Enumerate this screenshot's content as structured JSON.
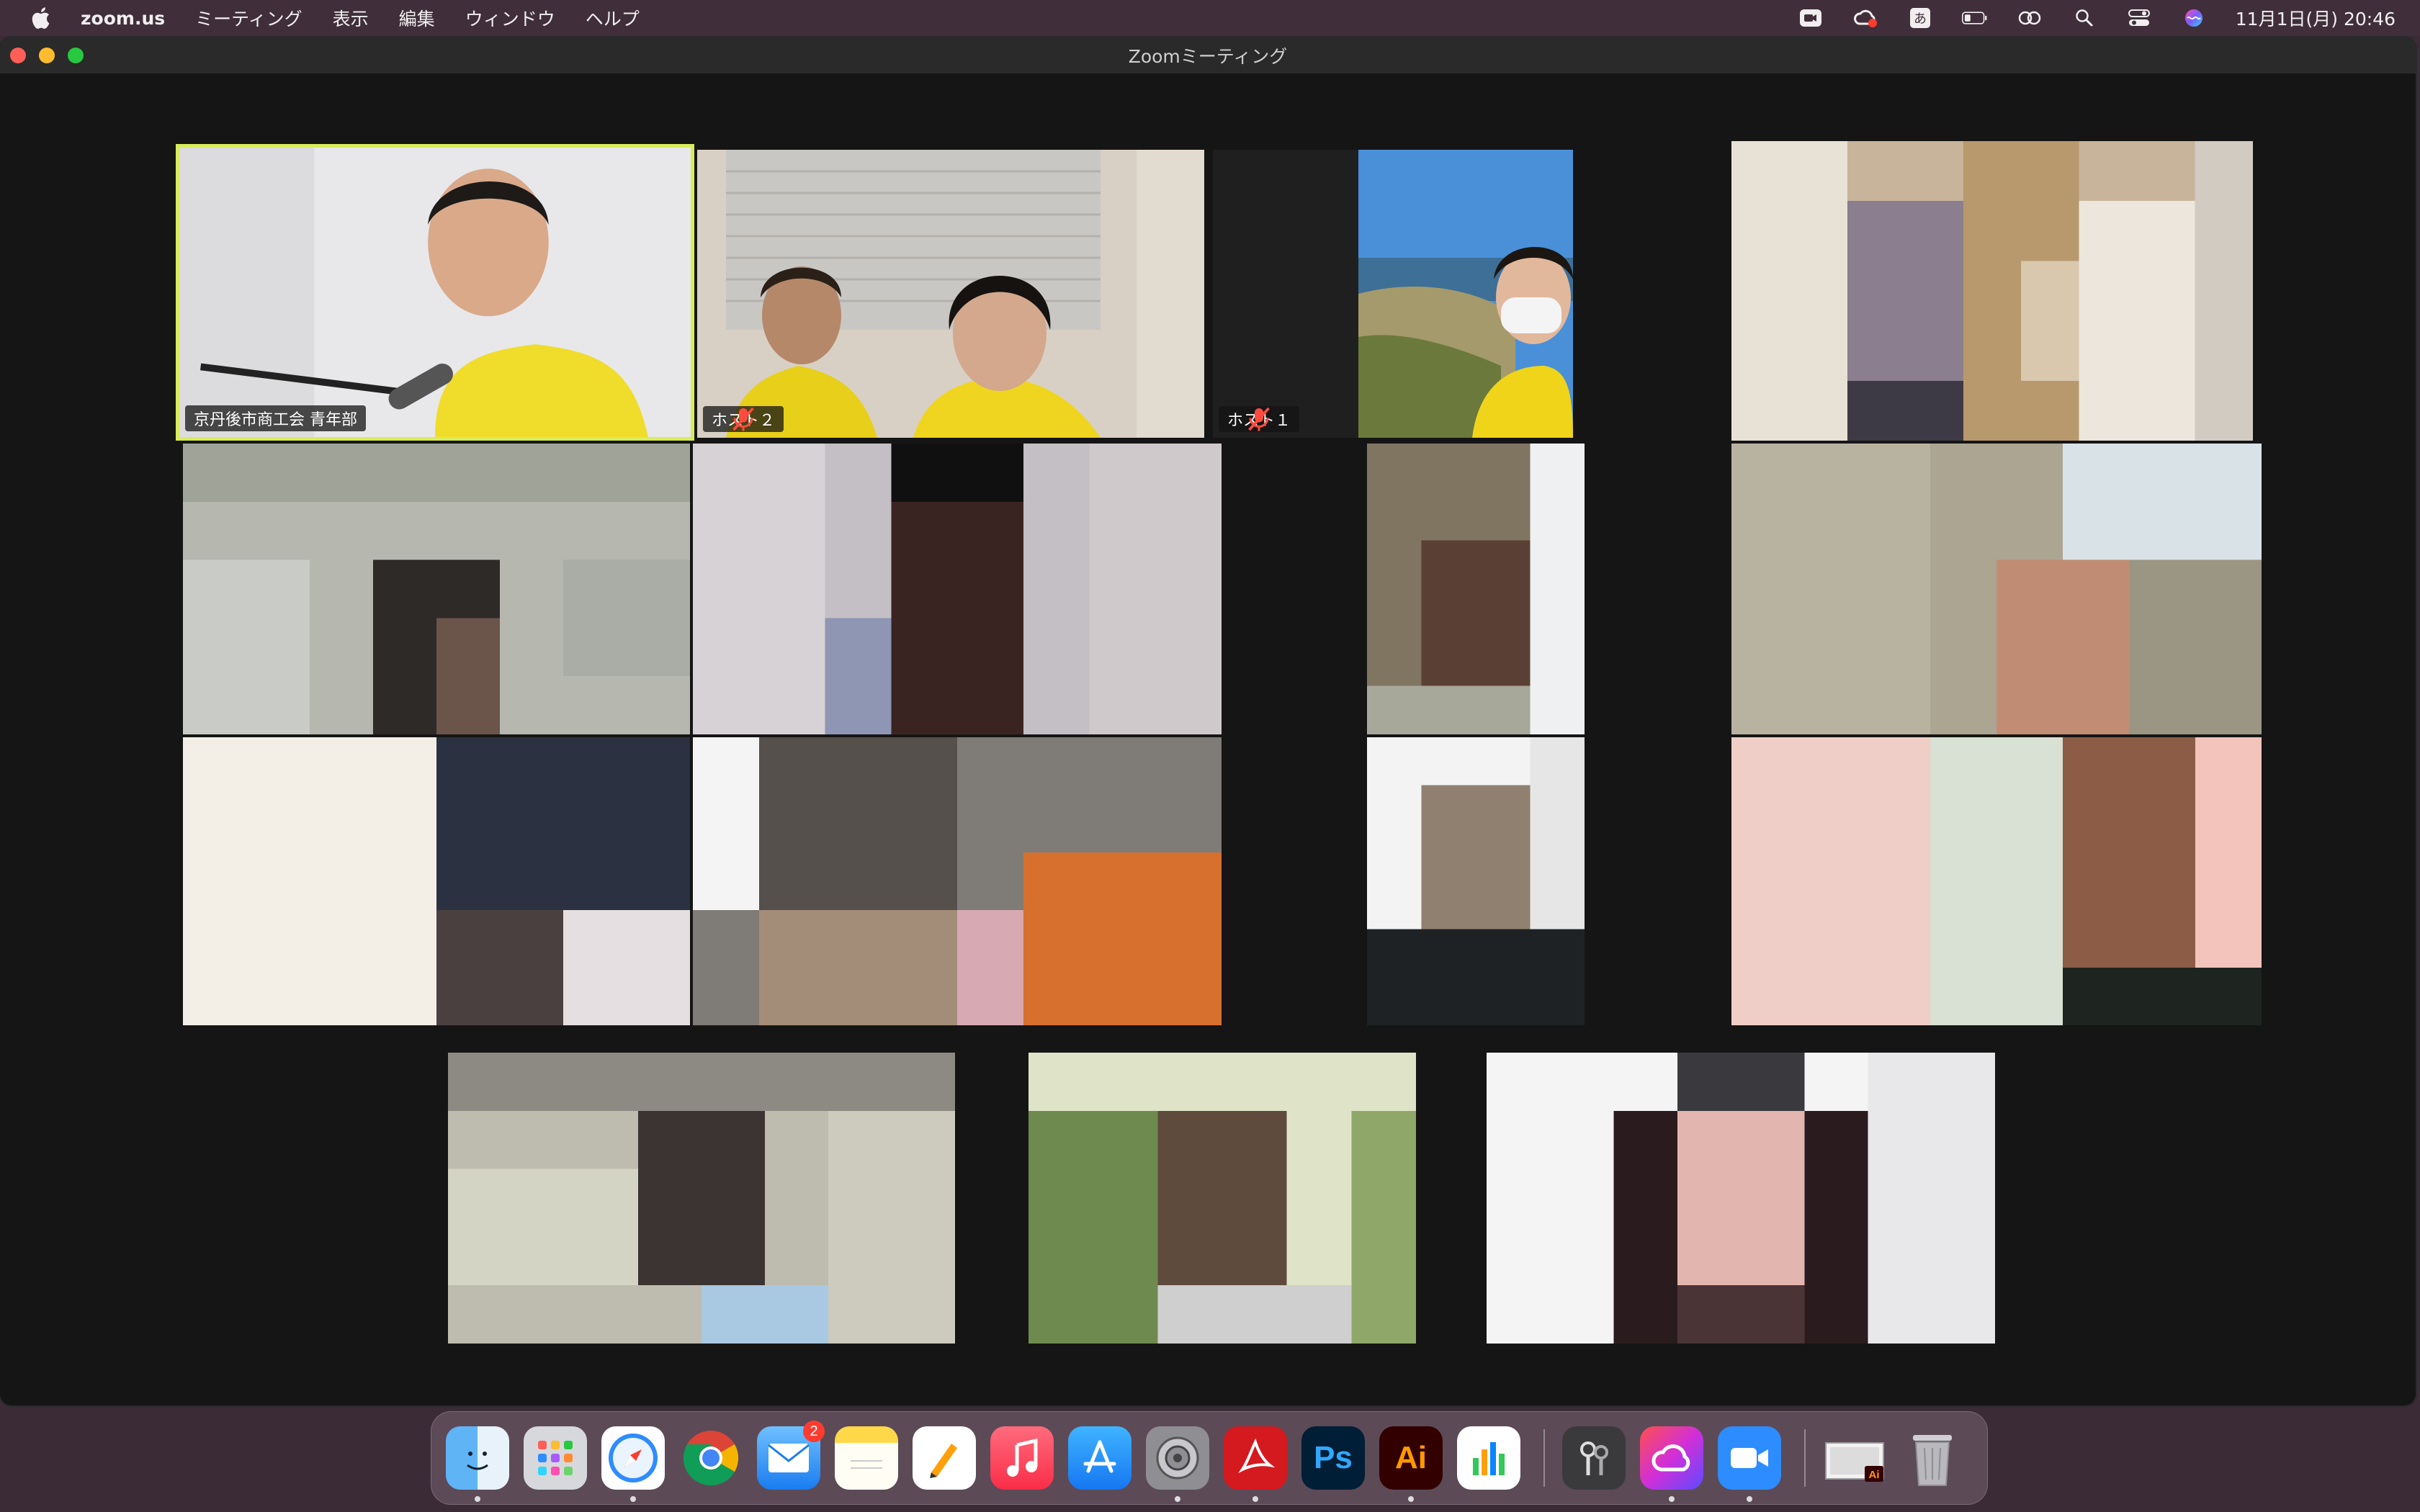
{
  "menubar": {
    "app_name": "zoom.us",
    "menus": [
      "ミーティング",
      "表示",
      "編集",
      "ウィンドウ",
      "ヘルプ"
    ],
    "input_mode": "あ",
    "clock": "11月1日(月)  20:46"
  },
  "window": {
    "title": "Zoomミーティング"
  },
  "participants": {
    "speaker_name": "京丹後市商工会 青年部",
    "host2_name": "ホスト２",
    "host1_name": "ホスト１"
  },
  "dock": {
    "mail_badge": "2",
    "apps": [
      "Finder",
      "Launchpad",
      "Safari",
      "Chrome",
      "Mail",
      "Notes",
      "Pages",
      "Music",
      "App Store",
      "System Preferences",
      "Acrobat",
      "Photoshop",
      "Illustrator",
      "Numbers",
      "Keychain Access",
      "Creative Cloud",
      "Zoom",
      "Illustrator Document",
      "Trash"
    ]
  },
  "colors": {
    "active_speaker_border": "#d8ec5a",
    "window_background": "#151515",
    "mute_icon": "#ff4b3e"
  }
}
